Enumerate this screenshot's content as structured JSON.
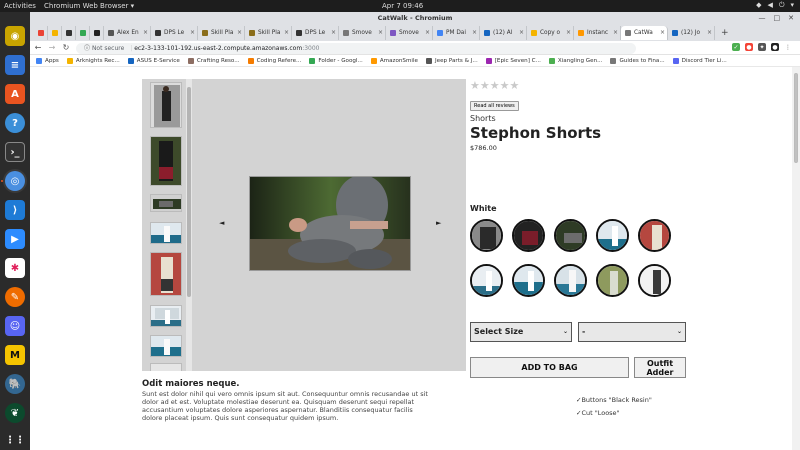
{
  "system": {
    "activities": "Activities",
    "app_menu": "Chromium Web Browser ▾",
    "clock": "Apr 7  09:46"
  },
  "window": {
    "title": "CatWalk - Chromium"
  },
  "tabs": [
    {
      "label": "",
      "color": "#ea4335"
    },
    {
      "label": "",
      "color": "#f4b400"
    },
    {
      "label": "",
      "color": "#333333"
    },
    {
      "label": "",
      "color": "#34a853"
    },
    {
      "label": "",
      "color": "#222222"
    },
    {
      "label": "Alex En",
      "color": "#555555"
    },
    {
      "label": "DPS Le",
      "color": "#333333"
    },
    {
      "label": "Skill Pla",
      "color": "#8a6d1a"
    },
    {
      "label": "Skill Pla",
      "color": "#8a6d1a"
    },
    {
      "label": "DPS Le",
      "color": "#333333"
    },
    {
      "label": "Smove",
      "color": "#777777"
    },
    {
      "label": "Smove",
      "color": "#7e57c2"
    },
    {
      "label": "PM Dai",
      "color": "#4285f4"
    },
    {
      "label": "(12) Al",
      "color": "#1565c0"
    },
    {
      "label": "Copy o",
      "color": "#f4b400"
    },
    {
      "label": "Instanc",
      "color": "#ff9800"
    },
    {
      "label": "CatWa",
      "color": "#777777"
    },
    {
      "label": "(12) Jo",
      "color": "#1565c0"
    }
  ],
  "address": {
    "not_secure": "Not secure",
    "host": "ec2-3-133-101-192.us-east-2.compute.amazonaws.com",
    "port": ":3000"
  },
  "bookmarks": [
    "Apps",
    "Arknights Rec...",
    "ASUS E-Service",
    "Crafting Reso...",
    "Coding Refere...",
    "Folder - Googl...",
    "AmazonSmile",
    "Jeep Parts & J...",
    "[Epic Seven] C...",
    "Xiangling Gen...",
    "Guides to Fina...",
    "Discord Tier Li..."
  ],
  "product": {
    "read_reviews_label": "Read all reviews",
    "rating_stars": 0,
    "category": "Shorts",
    "name": "Stephon Shorts",
    "price": "$786.00",
    "style_name": "White",
    "size_select": "Select Size",
    "quantity_select": "-",
    "add_to_bag_label": "ADD TO BAG",
    "outfit_adder_label": "Outfit Adder",
    "gallery_prev": "◄",
    "gallery_next": "►"
  },
  "description": {
    "slogan": "Odit maiores neque.",
    "body": "Sunt est dolor nihil qui vero omnis ipsum sit aut. Consequuntur omnis recusandae ut sit dolor ad et est. Voluptate molestiae deserunt ea. Quisquam deserunt sequi repellat accusantium voluptates dolore asperiores aspernatur. Blanditiis consequatur facilis dolore placeat ipsum. Quis sunt consequatur quidem ipsum.",
    "features": [
      "✓Buttons \"Black Resin\"",
      "✓Cut \"Loose\""
    ]
  },
  "colors": {
    "background_gray": "#d3d3d3",
    "dock": "#2b2b2b",
    "tab_strip": "#dfe1e5"
  }
}
